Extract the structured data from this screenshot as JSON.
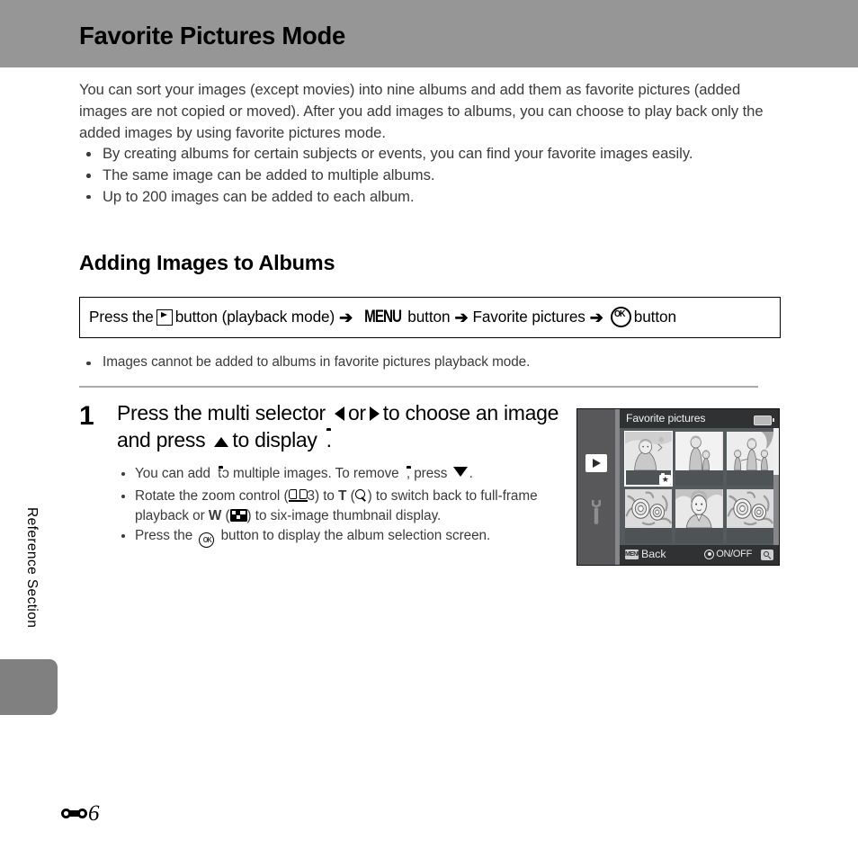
{
  "page": {
    "title": "Favorite Pictures Mode",
    "side_label": "Reference Section",
    "page_number": "6",
    "page_prefix_icon": "reference-section-glyph"
  },
  "intro": {
    "paragraph": "You can sort your images (except movies) into nine albums and add them as favorite pictures (added images are not copied or moved). After you add images to albums, you can choose to play back only the added images by using favorite pictures mode.",
    "bullets": [
      "By creating albums for certain subjects or events, you can find your favorite images easily.",
      "The same image can be added to multiple albums.",
      "Up to 200 images can be added to each album."
    ]
  },
  "section": {
    "heading": "Adding Images to Albums",
    "instruction": {
      "part1": "Press the",
      "icon1": "playback-button-icon",
      "part2": "button (playback mode)",
      "arrow1": "➔",
      "icon2": "MENU",
      "part3": "button",
      "arrow2": "➔",
      "part4": "Favorite pictures",
      "arrow3": "➔",
      "icon3": "ok-button-icon",
      "part5": "button"
    },
    "note_bullet": "Images cannot be added to albums in favorite pictures playback mode."
  },
  "step1": {
    "number": "1",
    "head_a": "Press the multi selector",
    "head_icon_left": "left-triangle-icon",
    "head_or": "or",
    "head_icon_right": "right-triangle-icon",
    "head_b": "to choose an image and press",
    "head_icon_up": "up-triangle-icon",
    "head_c": "to display",
    "head_icon_fav": "favorite-tag-icon",
    "head_period": ".",
    "bullets": {
      "b1_a": "You can add",
      "b1_icon1": "favorite-tag-icon",
      "b1_b": "to multiple images. To remove",
      "b1_icon2": "favorite-tag-icon",
      "b1_c": ", press",
      "b1_icon3": "down-triangle-icon",
      "b1_d": ".",
      "b2_a": "Rotate the zoom control (",
      "b2_icon_book": "open-book-icon",
      "b2_ref": "3",
      "b2_b": ") to",
      "b2_t": "T",
      "b2_c": "(",
      "b2_icon_mag": "magnifier-icon",
      "b2_d": ") to switch back to full-frame playback or",
      "b2_w": "W",
      "b2_e": "(",
      "b2_icon_grid": "thumbnail-grid-icon",
      "b2_f": ") to six-image thumbnail display.",
      "b3_a": "Press the",
      "b3_icon_ok": "ok-button-icon",
      "b3_b": "button to display the album selection screen."
    }
  },
  "camera_screen": {
    "title": "Favorite pictures",
    "battery_icon": "battery-icon",
    "sidebar": [
      {
        "name": "playback-mode-icon",
        "selected": true
      },
      {
        "name": "setup-wrench-icon",
        "selected": false
      }
    ],
    "thumbnails": [
      {
        "id": 1,
        "subject": "woman-outdoors",
        "selected": true,
        "favorite_tag": true
      },
      {
        "id": 2,
        "subject": "woman-with-child",
        "selected": false,
        "favorite_tag": false
      },
      {
        "id": 3,
        "subject": "family-group",
        "selected": false,
        "favorite_tag": false
      },
      {
        "id": 4,
        "subject": "flowers",
        "selected": false,
        "favorite_tag": false
      },
      {
        "id": 5,
        "subject": "portrait",
        "selected": false,
        "favorite_tag": false
      },
      {
        "id": 6,
        "subject": "flowers",
        "selected": false,
        "favorite_tag": false
      }
    ],
    "bottom_bar": {
      "menu_badge": "MENU",
      "back_label": "Back",
      "multiselector_icon": "multi-selector-icon",
      "onoff_label": "ON/OFF",
      "zoom_icon": "magnifier-button-icon"
    }
  },
  "colors": {
    "header_band": "#969696",
    "side_tab": "#808080",
    "body_text": "#3b3b3b",
    "screen_bg": "#555a5c",
    "screen_bar": "#2f3133"
  }
}
